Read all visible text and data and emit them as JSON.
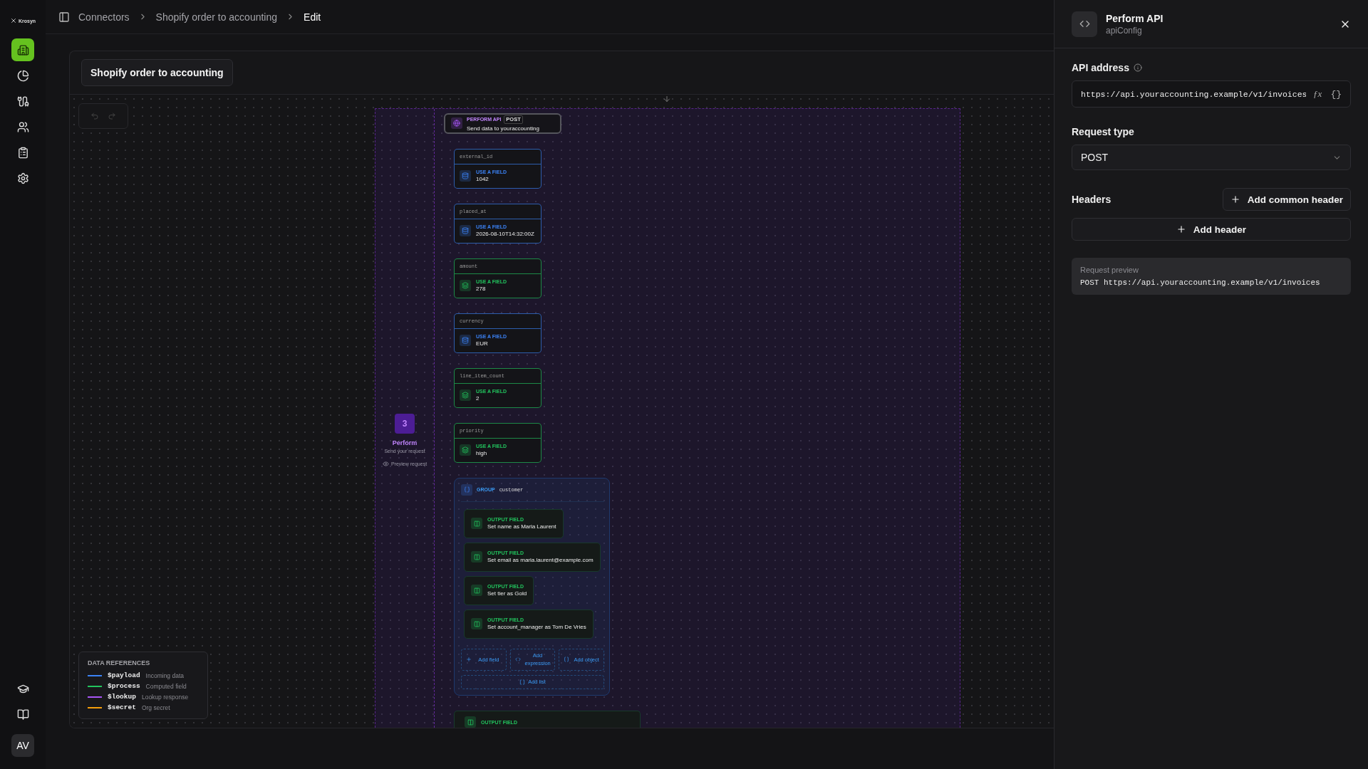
{
  "sidebar": {
    "logo": "Krosyn",
    "items": [
      {
        "kind": "building",
        "selected": true
      },
      {
        "kind": "chart",
        "selected": false
      },
      {
        "kind": "plug",
        "selected": false
      },
      {
        "kind": "users",
        "selected": false
      },
      {
        "kind": "clipboard",
        "selected": false
      },
      {
        "kind": "settings",
        "selected": false
      }
    ],
    "bottom_items": [
      {
        "kind": "learn"
      },
      {
        "kind": "docs"
      }
    ],
    "avatar": "AV"
  },
  "breadcrumb": [
    "Connectors",
    "Shopify order to accounting",
    "Edit"
  ],
  "canvas": {
    "title": "Shopify order to accounting",
    "step": {
      "number": "3",
      "title": "Perform",
      "subtitle": "Send your request",
      "preview": "Preview request"
    },
    "api_node": {
      "label": "PERFORM API",
      "method": "POST",
      "title": "Send data to youraccounting"
    },
    "fields": [
      {
        "name": "external_id",
        "tag": "USE A FIELD",
        "value": "1042",
        "color": "#3b82f6"
      },
      {
        "name": "placed_at",
        "tag": "USE A FIELD",
        "value": "2026-08-10T14:32:00Z",
        "color": "#3b82f6"
      },
      {
        "name": "amount",
        "tag": "USE A FIELD",
        "value": "278",
        "color": "#22c55e"
      },
      {
        "name": "currency",
        "tag": "USE A FIELD",
        "value": "EUR",
        "color": "#3b82f6"
      },
      {
        "name": "line_item_count",
        "tag": "USE A FIELD",
        "value": "2",
        "color": "#22c55e"
      },
      {
        "name": "priority",
        "tag": "USE A FIELD",
        "value": "high",
        "color": "#22c55e"
      }
    ],
    "group": {
      "label": "GROUP",
      "name": "customer",
      "outputs": [
        {
          "tag": "OUTPUT FIELD",
          "text": "Set name as Maria Laurent"
        },
        {
          "tag": "OUTPUT FIELD",
          "text": "Set email as maria.laurent@example.com"
        },
        {
          "tag": "OUTPUT FIELD",
          "text": "Set tier as Gold"
        },
        {
          "tag": "OUTPUT FIELD",
          "text": "Set account_manager as Tom De Vries"
        }
      ],
      "actions": [
        {
          "kind": "field",
          "label": "Add field"
        },
        {
          "kind": "expression",
          "label": "Add expression"
        },
        {
          "kind": "object",
          "label": "Add object"
        }
      ],
      "add_list": "Add list"
    },
    "trailing_output": {
      "tag": "OUTPUT FIELD"
    },
    "references": {
      "title": "DATA REFERENCES",
      "items": [
        {
          "name": "$payload",
          "description": "Incoming data",
          "color": "#3b82f6"
        },
        {
          "name": "$process",
          "description": "Computed field",
          "color": "#22c55e"
        },
        {
          "name": "$lookup",
          "description": "Lookup response",
          "color": "#a855f7"
        },
        {
          "name": "$secret",
          "description": "Org secret",
          "color": "#f59e0b"
        }
      ]
    }
  },
  "panel": {
    "title": "Perform API",
    "subtitle": "apiConfig",
    "api_address_label": "API address",
    "api_address": "https://api.youraccounting.example/v1/invoices",
    "fx": "ƒx",
    "braces": "{}",
    "request_type_label": "Request type",
    "request_type": "POST",
    "headers_label": "Headers",
    "add_common_header": "Add common header",
    "add_header": "Add header",
    "preview_label": "Request preview",
    "preview": "POST https://api.youraccounting.example/v1/invoices"
  }
}
